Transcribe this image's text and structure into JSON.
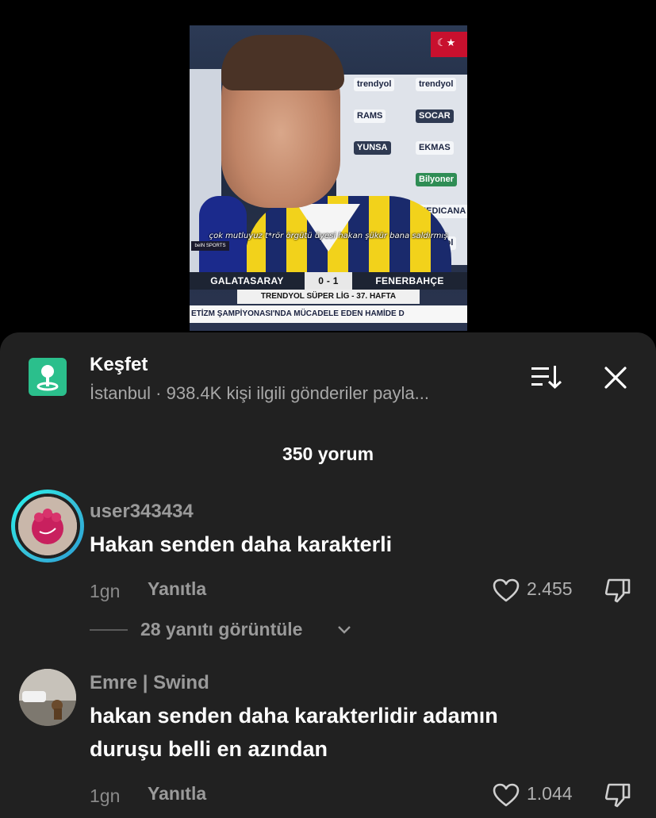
{
  "video": {
    "subtitle": "çok mutluyuz t*rör örgütü üyesi hakan şükür bana saldırmış",
    "score": {
      "home_team": "GALATASARAY",
      "score": "0 - 1",
      "away_team": "FENERBAHÇE",
      "league": "TRENDYOL SÜPER LİG - 37. HAFTA"
    },
    "ticker": "ETİZM ŞAMPİYONASI'NDA MÜCADELE EDEN HAMİDE D",
    "board_logos": [
      "trendyol",
      "trendyol",
      "RAMS",
      "SOCAR",
      "YUNSA",
      "EKMAS",
      "Bilyoner",
      "MEDICANA",
      "trendyol"
    ],
    "mic_tag": "beIN SPORTS"
  },
  "sheet": {
    "explore_title": "Keşfet",
    "explore_sub": "İstanbul · 938.4K kişi ilgili gönderiler payla...",
    "comment_count": "350 yorum",
    "icons": {
      "explore": "map-pin-icon",
      "sort": "sort-icon",
      "close": "close-icon"
    },
    "accent": "#2bbf8c"
  },
  "comments": [
    {
      "username": "user343434",
      "text": "Hakan senden daha karakterli",
      "time": "1gn",
      "reply_label": "Yanıtla",
      "likes": "2.455",
      "replies": "28 yanıtı görüntüle"
    },
    {
      "username": "Emre | Swind",
      "text_line1": "hakan senden daha karakterlidir adamın",
      "text_line2": "duruşu belli en azından",
      "time": "1gn",
      "reply_label": "Yanıtla",
      "likes": "1.044"
    }
  ]
}
